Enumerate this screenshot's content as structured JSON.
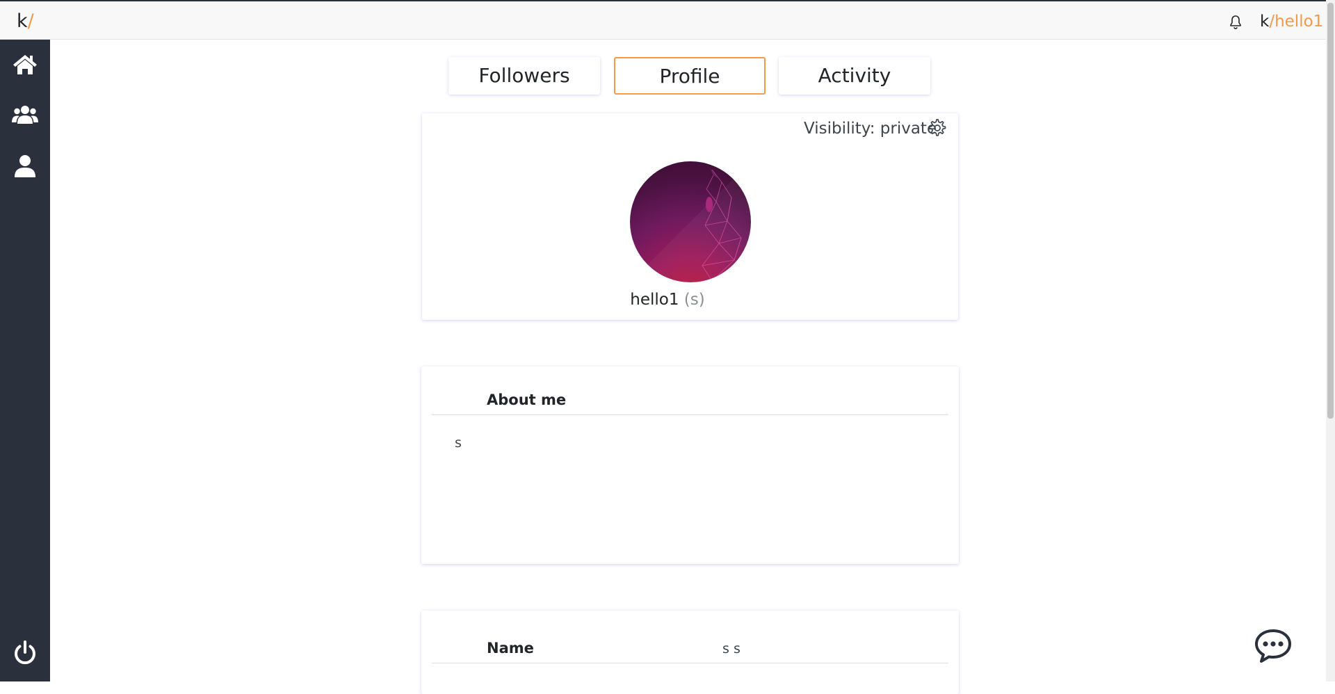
{
  "app": {
    "logo_k": "k",
    "logo_slash": "/",
    "user_prefix": "k",
    "user_slash": "/",
    "username": "hello1",
    "accent_color": "#f2994a",
    "sidebar_color": "#2b313c"
  },
  "sidebar": {
    "items": [
      {
        "icon": "home-icon"
      },
      {
        "icon": "group-icon"
      },
      {
        "icon": "user-icon"
      }
    ],
    "bottom_icon": "power-icon"
  },
  "tabs": [
    {
      "label": "Followers"
    },
    {
      "label": "Profile",
      "active": true
    },
    {
      "label": "Activity"
    }
  ],
  "profile": {
    "visibility_label": "Visibility: private",
    "display_name": "hello1",
    "handle": "(s)"
  },
  "about": {
    "title": "About me",
    "text": "s"
  },
  "details": {
    "name_label": "Name",
    "name_value": "s s"
  }
}
